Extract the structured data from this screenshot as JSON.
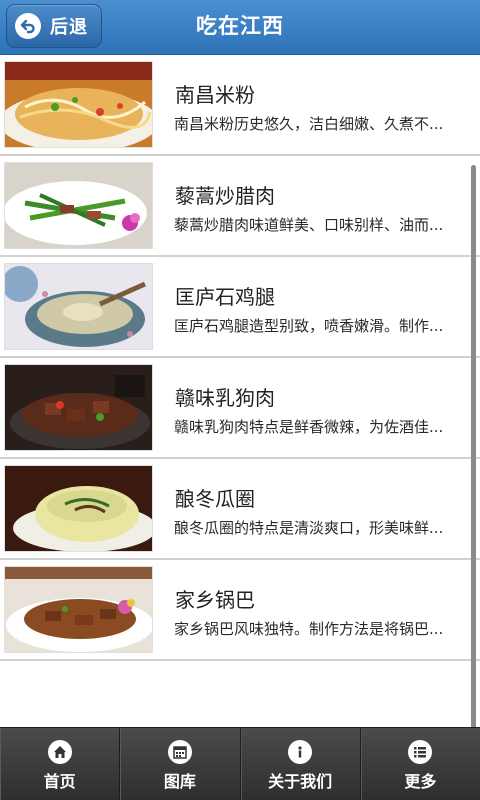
{
  "header": {
    "back_label": "后退",
    "title": "吃在江西"
  },
  "items": [
    {
      "title": "南昌米粉",
      "desc": "南昌米粉历史悠久，洁白细嫩、久煮不..."
    },
    {
      "title": "藜蒿炒腊肉",
      "desc": "藜蒿炒腊肉味道鲜美、口味别样、油而..."
    },
    {
      "title": "匡庐石鸡腿",
      "desc": "匡庐石鸡腿造型别致，喷香嫩滑。制作..."
    },
    {
      "title": "赣味乳狗肉",
      "desc": "赣味乳狗肉特点是鲜香微辣，为佐酒佳..."
    },
    {
      "title": "酿冬瓜圈",
      "desc": "酿冬瓜圈的特点是清淡爽口，形美味鲜..."
    },
    {
      "title": "家乡锅巴",
      "desc": "家乡锅巴风味独特。制作方法是将锅巴..."
    }
  ],
  "nav": [
    {
      "label": "首页",
      "icon": "home-icon"
    },
    {
      "label": "图库",
      "icon": "calendar-grid-icon"
    },
    {
      "label": "关于我们",
      "icon": "info-icon"
    },
    {
      "label": "更多",
      "icon": "list-icon"
    }
  ],
  "colors": {
    "header": "#2f73b8",
    "bottom_nav": "#3a3a3a",
    "divider": "#d2d2d2"
  }
}
